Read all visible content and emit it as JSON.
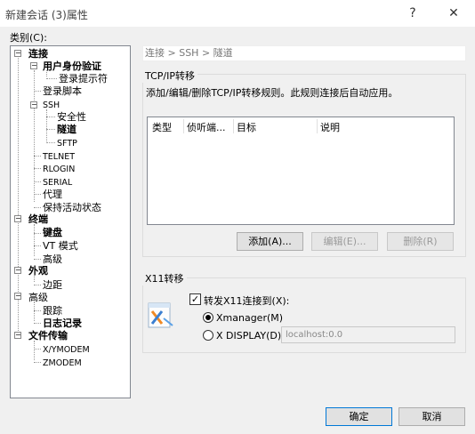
{
  "window": {
    "title": "新建会话 (3)属性",
    "help_glyph": "?",
    "close_glyph": "✕"
  },
  "category_label": "类别(C):",
  "tree": {
    "conn": "连接",
    "auth": "用户身份验证",
    "login_prompt": "登录提示符",
    "login_script": "登录脚本",
    "ssh": "SSH",
    "security": "安全性",
    "tunnel": "隧道",
    "sftp": "SFTP",
    "telnet": "TELNET",
    "rlogin": "RLOGIN",
    "serial": "SERIAL",
    "proxy": "代理",
    "keepalive": "保持活动状态",
    "terminal": "终端",
    "keyboard": "键盘",
    "vt": "VT 模式",
    "advanced1": "高级",
    "appearance": "外观",
    "margin": "边距",
    "advanced2": "高级",
    "trace": "跟踪",
    "log": "日志记录",
    "file_transfer": "文件传输",
    "xymodem": "X/YMODEM",
    "zmodem": "ZMODEM",
    "expander_minus": "−"
  },
  "breadcrumb": "连接 > SSH > 隧道",
  "tcp": {
    "group_title": "TCP/IP转移",
    "description": "添加/编辑/删除TCP/IP转移规则。此规则连接后自动应用。",
    "columns": [
      "类型",
      "侦听端...",
      "目标",
      "说明"
    ],
    "add_label": "添加(A)...",
    "edit_label": "编辑(E)...",
    "delete_label": "删除(R)"
  },
  "x11": {
    "group_title": "X11转移",
    "forward_label": "转发X11连接到(X):",
    "forward_checked": true,
    "check_glyph": "✓",
    "xmanager_label": "Xmanager(M)",
    "xdisplay_label": "X DISPLAY(D):",
    "xdisplay_value": "localhost:0.0",
    "selected": "xmanager"
  },
  "footer": {
    "ok_label": "确定",
    "cancel_label": "取消"
  },
  "colors": {
    "dialog_bg": "#f0f0f0",
    "accent_border": "#0078d7",
    "disabled_text": "#9a9a9a"
  }
}
